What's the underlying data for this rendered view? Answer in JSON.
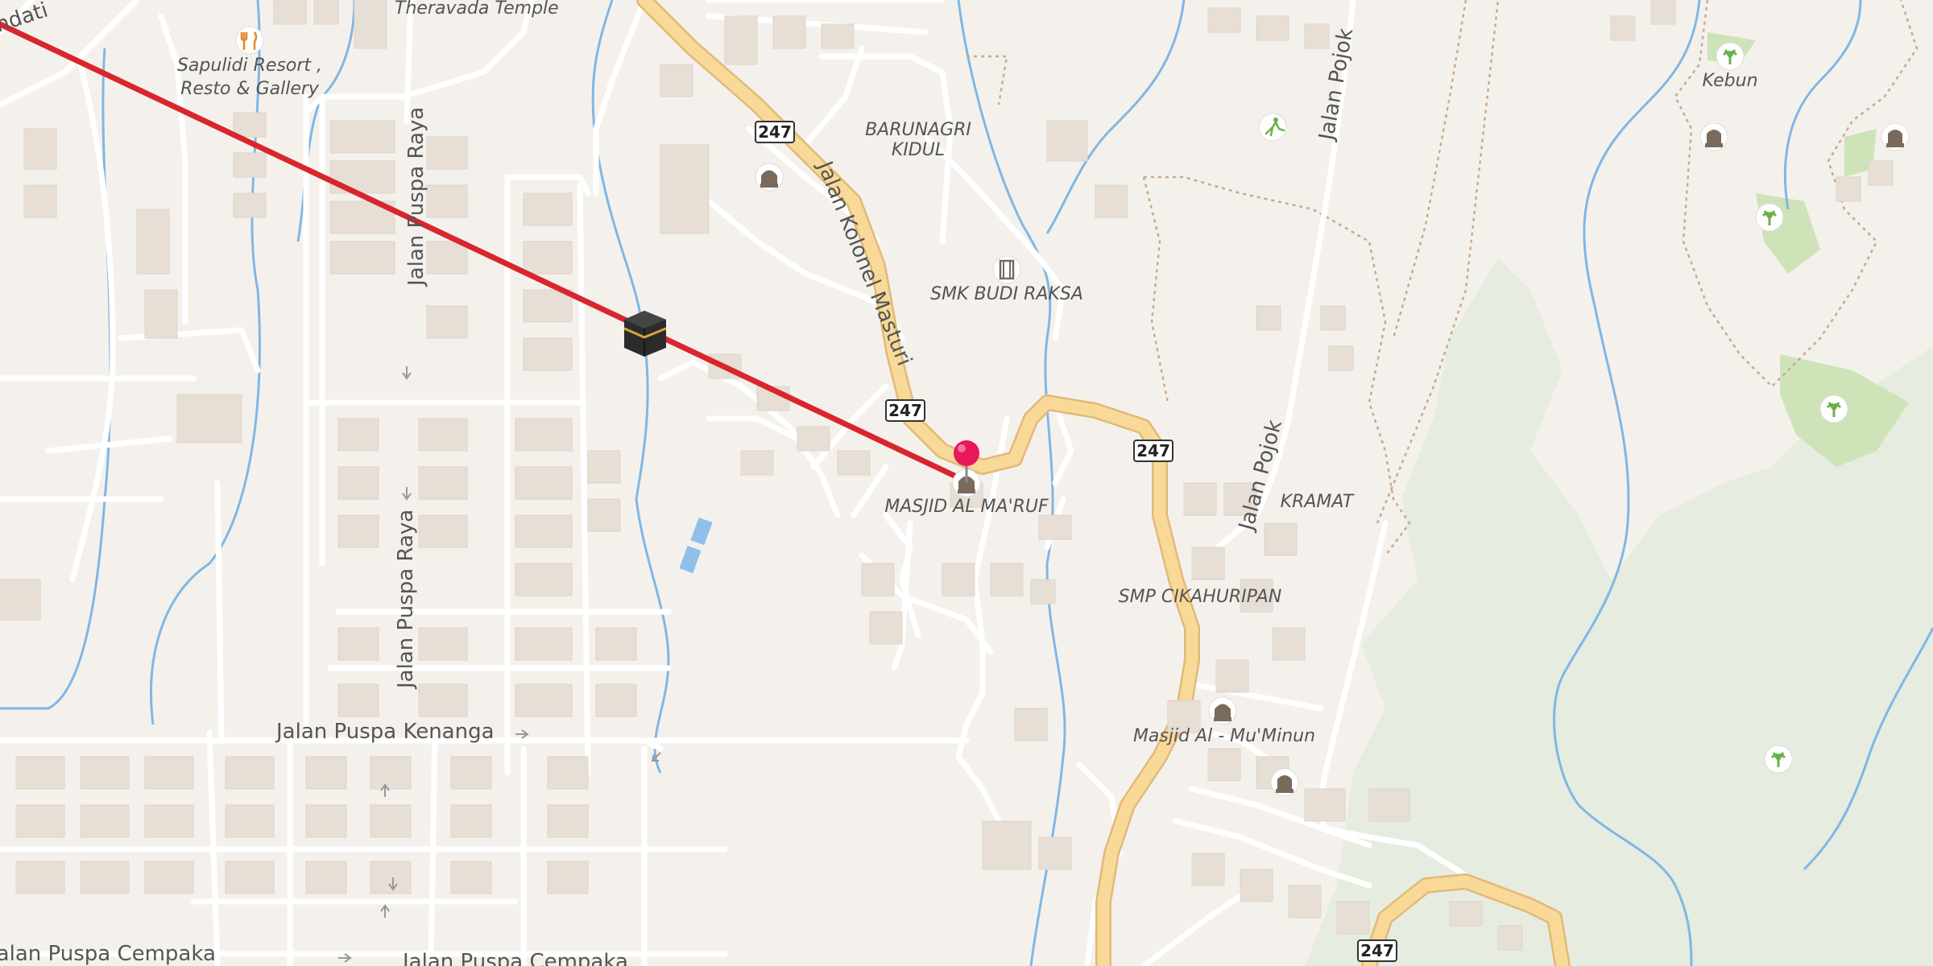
{
  "map": {
    "labels": {
      "theravada": "Theravada Temple",
      "sapulidi_1": "Sapulidi Resort ,",
      "sapulidi_2": "Resto & Gallery",
      "ndati": "ndati",
      "barunagri_1": "BARUNAGRI",
      "barunagri_2": "KIDUL",
      "smk": "SMK BUDI RAKSA",
      "masjid_maruf": "MASJID AL MA'RUF",
      "smp": "SMP CIKAHURIPAN",
      "masjid_muminun": "Masjid Al - Mu'Minun",
      "kramat": "KRAMAT",
      "kebun": "Kebun"
    },
    "roads": {
      "puspa_raya_top": "Jalan Puspa Raya",
      "puspa_raya_bottom": "Jalan Puspa Raya",
      "puspa_kenanga": "Jalan Puspa Kenanga",
      "puspa_cempaka_left": "Jalan Puspa Cempaka",
      "puspa_cempaka_right": "Jalan Puspa Cempaka",
      "kolonel_masturi": "Jalan Kolonel Masturi",
      "pojok_top": "Jalan Pojok",
      "pojok_mid": "Jalan Pojok"
    },
    "shields": [
      "247",
      "247",
      "247",
      "247"
    ],
    "colors": {
      "qibla_line": "#d9262e",
      "pin": "#e8185a",
      "road_major": "#f9d998",
      "road_major_edge": "#e2b978",
      "water": "#6aaee0",
      "forest": "#e6ecdf",
      "building": "#e7dfd6",
      "poi_icon": "#7a6a5c",
      "park_icon": "#6ab04c"
    },
    "icons": [
      "restaurant-icon",
      "kaaba-icon",
      "mosque-icon",
      "school-icon",
      "sports-icon",
      "cemetery-icon",
      "garden-icon",
      "location-pin-icon"
    ]
  }
}
